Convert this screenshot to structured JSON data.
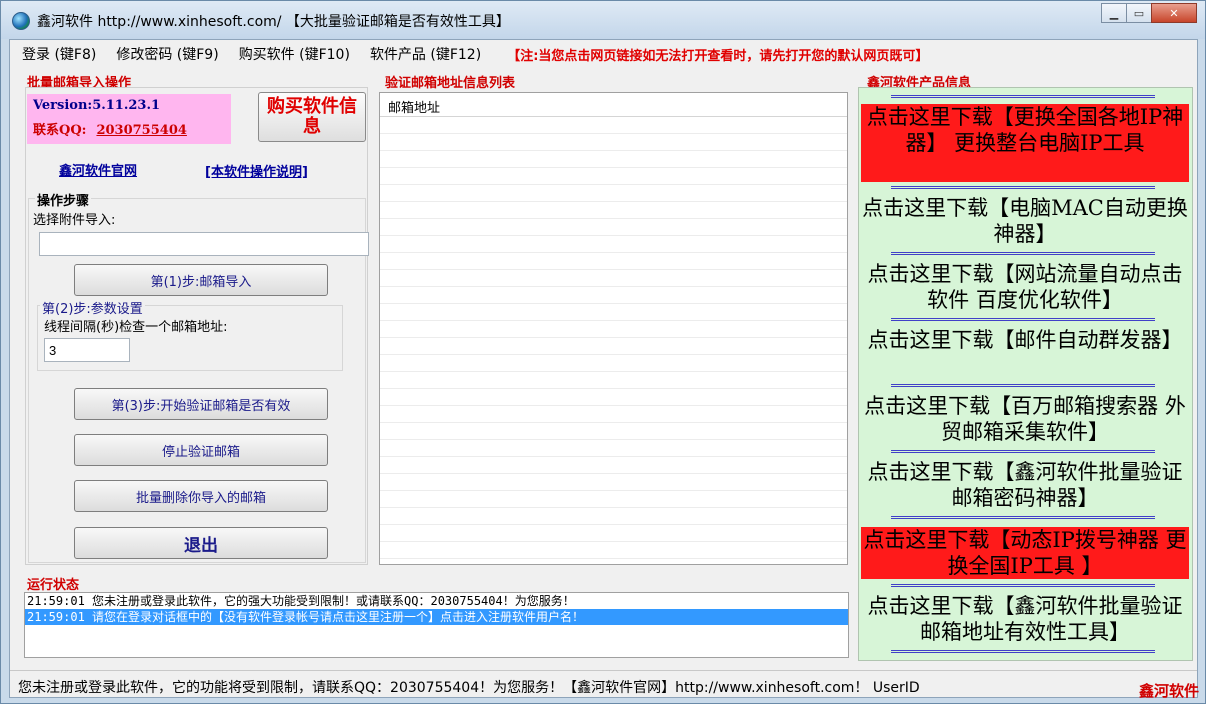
{
  "window": {
    "title": "鑫河软件 http://www.xinhesoft.com/ 【大批量验证邮箱是否有效性工具】",
    "minimize_glyph": "▁",
    "maximize_glyph": "▭",
    "close_glyph": "✕"
  },
  "menu": {
    "items": [
      "登录 (键F8)",
      "修改密码 (键F9)",
      "购买软件 (键F10)",
      "软件产品 (键F12)"
    ],
    "note": "【注:当您点击网页链接如无法打开查看时，请先打开您的默认网页既可】"
  },
  "left": {
    "section_title": "批量邮箱导入操作",
    "version": "Version:5.11.23.1",
    "qq_label": "联系QQ:",
    "qq_number": "2030755404",
    "buy_button": "购买软件信息",
    "official_site_link": "鑫河软件官网",
    "manual_link": "[本软件操作说明]",
    "steps_title": "操作步骤",
    "attach_label": "选择附件导入:",
    "attach_value": "",
    "step1_button": "第(1)步:邮箱导入",
    "step2_title": "第(2)步:参数设置",
    "interval_label": "线程间隔(秒)检查一个邮箱地址:",
    "interval_value": "3",
    "step3_button": "第(3)步:开始验证邮箱是否有效",
    "stop_button": "停止验证邮箱",
    "delete_button": "批量删除你导入的邮箱",
    "exit_button": "退出"
  },
  "list": {
    "section_title": "验证邮箱地址信息列表",
    "column_header": "邮箱地址"
  },
  "right": {
    "section_title": "鑫河软件产品信息",
    "products": [
      {
        "label": "点击这里下载【更换全国各地IP神器】 更换整台电脑IP工具",
        "highlight": true
      },
      {
        "label": "点击这里下载【电脑MAC自动更换神器】",
        "highlight": false
      },
      {
        "label": "点击这里下载【网站流量自动点击软件 百度优化软件】",
        "highlight": false
      },
      {
        "label": "点击这里下载【邮件自动群发器】",
        "highlight": false
      },
      {
        "label": "点击这里下载【百万邮箱搜索器 外贸邮箱采集软件】",
        "highlight": false
      },
      {
        "label": "点击这里下载【鑫河软件批量验证邮箱密码神器】",
        "highlight": false
      },
      {
        "label": "点击这里下载【动态IP拨号神器 更换全国IP工具 】",
        "highlight": true
      },
      {
        "label": "点击这里下载【鑫河软件批量验证邮箱地址有效性工具】",
        "highlight": false
      }
    ]
  },
  "log": {
    "section_title": "运行状态",
    "lines": [
      "21:59:01 您未注册或登录此软件，它的强大功能受到限制！或请联系QQ：2030755404！为您服务！",
      "21:59:01 请您在登录对话框中的【没有软件登录帐号请点击这里注册一个】点击进入注册软件用户名！"
    ]
  },
  "status": {
    "text": "您未注册或登录此软件，它的功能将受到限制，请联系QQ：2030755404！为您服务！【鑫河软件官网】http://www.xinhesoft.com！ UserID",
    "watermark": "鑫河软件"
  },
  "colors": {
    "accent_red": "#d00000",
    "product_bg": "#d7f5d7",
    "product_highlight": "#ff1a1a",
    "selection_blue": "#3399ff"
  }
}
